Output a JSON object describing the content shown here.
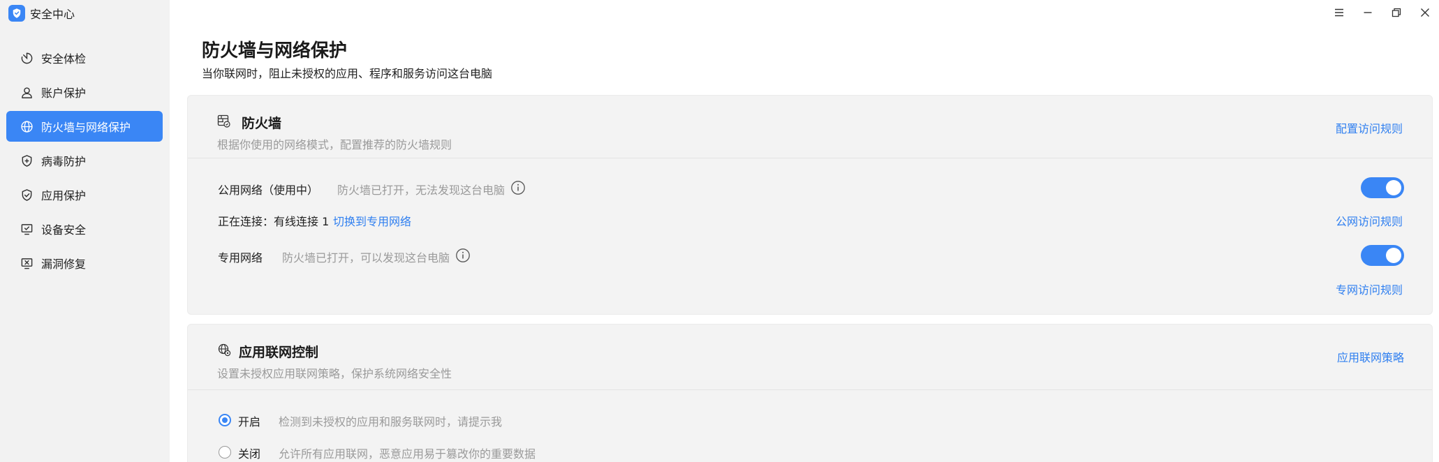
{
  "app": {
    "title": "安全中心",
    "logo_icon": "shield-icon",
    "accent": "#3a86f5"
  },
  "sidebar": {
    "items": [
      {
        "label": "安全体检",
        "icon": "scan-icon",
        "active": false
      },
      {
        "label": "账户保护",
        "icon": "user-icon",
        "active": false
      },
      {
        "label": "防火墙与网络保护",
        "icon": "globe-icon",
        "active": true
      },
      {
        "label": "病毒防护",
        "icon": "shield-plus-icon",
        "active": false
      },
      {
        "label": "应用保护",
        "icon": "shield-check-icon",
        "active": false
      },
      {
        "label": "设备安全",
        "icon": "monitor-check-icon",
        "active": false
      },
      {
        "label": "漏洞修复",
        "icon": "monitor-x-icon",
        "active": false
      }
    ]
  },
  "window_controls": [
    "menu-icon",
    "minimize-icon",
    "restore-icon",
    "close-icon"
  ],
  "page": {
    "title": "防火墙与网络保护",
    "description": "当你联网时，阻止未授权的应用、程序和服务访问这台电脑"
  },
  "firewall": {
    "title": "防火墙",
    "subtitle": "根据你使用的网络模式，配置推荐的防火墙规则",
    "config_link": "配置访问规则",
    "public": {
      "label": "公用网络（使用中）",
      "status": "防火墙已打开，无法发现这台电脑",
      "enabled": true,
      "rules_link": "公网访问规则"
    },
    "connection": {
      "text": "正在连接：有线连接 1",
      "switch_link": "切换到专用网络"
    },
    "private": {
      "label": "专用网络",
      "status": "防火墙已打开，可以发现这台电脑",
      "enabled": true,
      "rules_link": "专网访问规则"
    }
  },
  "app_control": {
    "title": "应用联网控制",
    "subtitle": "设置未授权应用联网策略，保护系统网络安全性",
    "policy_link": "应用联网策略",
    "options": [
      {
        "label": "开启",
        "hint": "检测到未授权的应用和服务联网时，请提示我",
        "selected": true
      },
      {
        "label": "关闭",
        "hint": "允许所有应用联网，恶意应用易于篡改你的重要数据",
        "selected": false
      }
    ]
  }
}
